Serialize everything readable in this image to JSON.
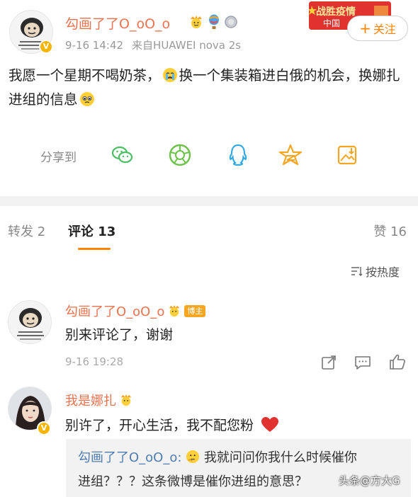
{
  "post": {
    "author": "勾画了了O_oO_o",
    "time": "9-16 14:42",
    "source": "来自HUAWEI nova 2s",
    "follow_label": "关注",
    "promo": {
      "line1": "战胜疫情",
      "line2": "中国"
    },
    "body_part1": "我愿一个星期不喝奶茶，",
    "body_part2": "换一个集装箱进白俄的机会，换娜扎进组的信息",
    "share_label": "分享到",
    "share_icons": [
      "wechat-icon",
      "moments-icon",
      "qq-icon",
      "qzone-icon",
      "save-image-icon"
    ]
  },
  "tabs": {
    "repost": "转发 2",
    "comments": "评论 13",
    "likes": "赞 16"
  },
  "sort": {
    "label": "按热度"
  },
  "comments": [
    {
      "author": "勾画了了O_oO_o",
      "badge": "博主",
      "text": "别来评论了，谢谢",
      "time": "9-16 19:28"
    },
    {
      "author": "我是娜扎",
      "text": "别许了，开心生活，我不配您粉",
      "reply": {
        "author": "勾画了了O_oO_o:",
        "text_line1": "我就问问你我什么时候催你",
        "text_line2": "进组？？？这条微博是催你进组的意思？"
      }
    }
  ],
  "watermark": "头条@方大G",
  "colors": {
    "accent_orange": "#ff8200",
    "name_orange": "#eb7350",
    "link_blue": "#507daf",
    "divider_gray": "#f2f2f2",
    "vip_gold": "#f7b500"
  }
}
